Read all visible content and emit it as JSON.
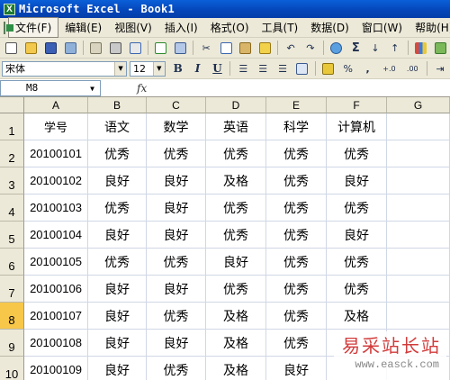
{
  "window": {
    "title": "Microsoft Excel - Book1",
    "logo": "X"
  },
  "menu": [
    "文件(F)",
    "编辑(E)",
    "视图(V)",
    "插入(I)",
    "格式(O)",
    "工具(T)",
    "数据(D)",
    "窗口(W)",
    "帮助(H)"
  ],
  "toolbar1": {
    "icons": [
      "new-icon",
      "open-icon",
      "save-icon",
      "permission-icon",
      "email-icon",
      "print-icon",
      "print-preview-icon",
      "spelling-icon",
      "research-icon",
      "cut-icon",
      "copy-icon",
      "paste-icon",
      "format-painter-icon",
      "undo-icon",
      "redo-icon",
      "hyperlink-icon",
      "autosum-icon",
      "sort-asc-icon",
      "sort-desc-icon",
      "chart-icon",
      "drawing-icon"
    ],
    "sigma": "Σ"
  },
  "toolbar2": {
    "font": "宋体",
    "size": "12",
    "bold": "B",
    "italic": "I",
    "underline": "U",
    "percent": "%",
    "comma": ",",
    "inc_decimal": "+.0",
    "dec_decimal": ".00"
  },
  "formula_bar": {
    "name_box": "M8",
    "fx": "fx",
    "content": ""
  },
  "sheet": {
    "columns": [
      "A",
      "B",
      "C",
      "D",
      "E",
      "F",
      "G"
    ],
    "row_numbers": [
      "1",
      "2",
      "3",
      "4",
      "5",
      "6",
      "7",
      "8",
      "9",
      "10"
    ],
    "active_row": "8",
    "rows": [
      [
        "学号",
        "语文",
        "数学",
        "英语",
        "科学",
        "计算机",
        ""
      ],
      [
        "20100101",
        "优秀",
        "优秀",
        "优秀",
        "优秀",
        "优秀",
        ""
      ],
      [
        "20100102",
        "良好",
        "良好",
        "及格",
        "优秀",
        "良好",
        ""
      ],
      [
        "20100103",
        "优秀",
        "良好",
        "优秀",
        "优秀",
        "优秀",
        ""
      ],
      [
        "20100104",
        "良好",
        "良好",
        "优秀",
        "优秀",
        "良好",
        ""
      ],
      [
        "20100105",
        "优秀",
        "优秀",
        "良好",
        "优秀",
        "优秀",
        ""
      ],
      [
        "20100106",
        "良好",
        "良好",
        "优秀",
        "优秀",
        "优秀",
        ""
      ],
      [
        "20100107",
        "良好",
        "优秀",
        "及格",
        "优秀",
        "及格",
        ""
      ],
      [
        "20100108",
        "良好",
        "良好",
        "及格",
        "优秀",
        "",
        ""
      ],
      [
        "20100109",
        "良好",
        "优秀",
        "及格",
        "良好",
        "",
        ""
      ]
    ]
  },
  "watermark": {
    "text": "易采站长站",
    "url": "www.easck.com"
  }
}
